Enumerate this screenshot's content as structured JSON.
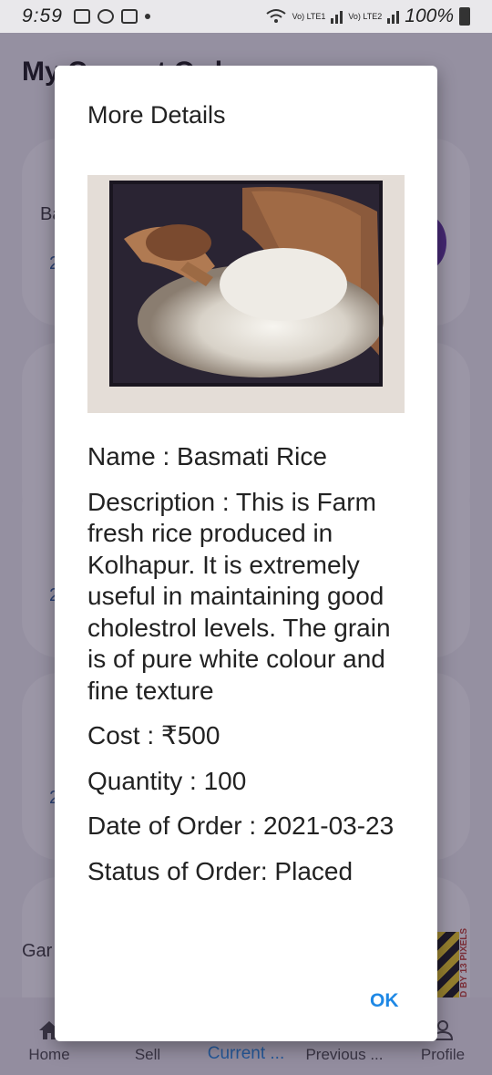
{
  "status_bar": {
    "time": "9:59",
    "battery": "100%",
    "sim1_label": "Vo) LTE1",
    "sim2_label": "Vo) LTE2"
  },
  "background": {
    "page_title": "My Current Orders",
    "cards": [
      {
        "text": "Ba",
        "num": "2"
      },
      {
        "text": "",
        "num": ""
      },
      {
        "text": "",
        "num": "2"
      },
      {
        "text": "",
        "num": "2"
      },
      {
        "text": "Gar",
        "num": ""
      }
    ],
    "watermark": "FLOWED BY 13 PIXELS"
  },
  "bottom_nav": {
    "items": [
      {
        "label": "Home",
        "icon": "home-icon"
      },
      {
        "label": "Sell",
        "icon": "sell-icon"
      },
      {
        "label": "Current ...",
        "icon": "current-orders-icon"
      },
      {
        "label": "Previous ...",
        "icon": "previous-orders-icon"
      },
      {
        "label": "Profile",
        "icon": "profile-icon"
      }
    ],
    "active_index": 2,
    "active_color": "#1e88e5"
  },
  "dialog": {
    "title": "More Details",
    "image_alt": "basmati-rice-photo",
    "name_line": "Name : Basmati Rice",
    "description_line": "Description : This is Farm fresh rice produced in Kolhapur. It is extremely useful in maintaining good cholestrol levels. The grain is of pure white colour and fine texture",
    "cost_line": "Cost : ₹500",
    "quantity_line": "Quantity : 100",
    "date_line": "Date of Order : 2021-03-23",
    "status_line": "Status of Order: Placed",
    "ok_label": "OK"
  }
}
